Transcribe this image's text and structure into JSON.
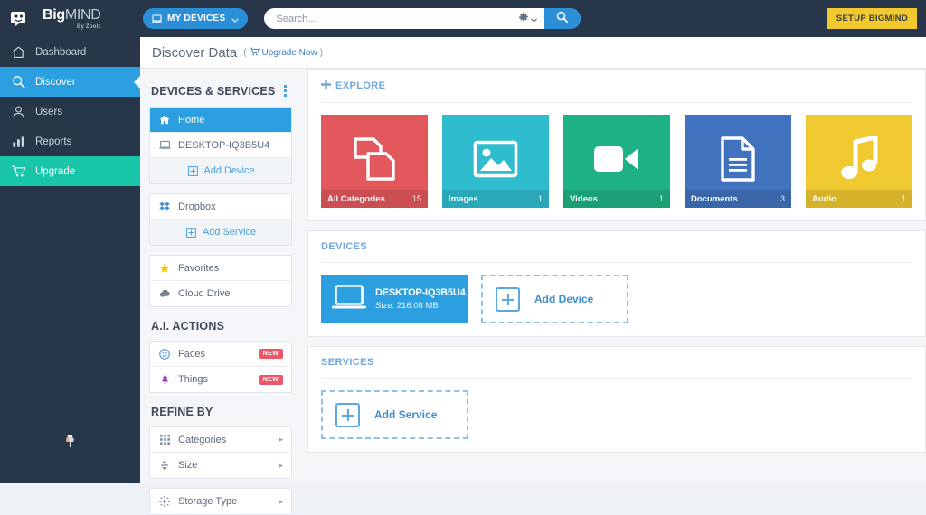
{
  "topbar": {
    "logo_main": "Big",
    "logo_dim": "MIND",
    "logo_sub": "By Zoolz",
    "my_devices_label": "MY DEVICES",
    "search_placeholder": "Search...",
    "setup_label": "SETUP BIGMIND"
  },
  "leftnav": {
    "items": [
      {
        "label": "Dashboard",
        "icon": "home-icon",
        "state": ""
      },
      {
        "label": "Discover",
        "icon": "search-icon",
        "state": "active"
      },
      {
        "label": "Users",
        "icon": "users-icon",
        "state": ""
      },
      {
        "label": "Reports",
        "icon": "chart-bar-icon",
        "state": ""
      },
      {
        "label": "Upgrade",
        "icon": "cart-icon",
        "state": "upgrade"
      }
    ],
    "pin_icon": "pushpin-icon"
  },
  "page": {
    "title": "Discover Data",
    "paren_open": "(",
    "upgrade_now": "Upgrade Now",
    "paren_close": ")"
  },
  "sidebar": {
    "devices_services_header": "DEVICES & SERVICES",
    "devices_items": [
      {
        "label": "Home",
        "icon": "home-icon",
        "kind": "sel"
      },
      {
        "label": "DESKTOP-IQ3B5U4",
        "icon": "laptop-icon",
        "kind": ""
      },
      {
        "label": "Add Device",
        "icon": "plus-square-icon",
        "kind": "add"
      }
    ],
    "services_items": [
      {
        "label": "Dropbox",
        "icon": "dropbox-icon",
        "kind": ""
      },
      {
        "label": "Add Service",
        "icon": "plus-square-icon",
        "kind": "add"
      }
    ],
    "extra_items": [
      {
        "label": "Favorites",
        "icon": "star-icon",
        "kind": ""
      },
      {
        "label": "Cloud Drive",
        "icon": "cloud-icon",
        "kind": ""
      }
    ],
    "ai_header": "A.I. ACTIONS",
    "ai_items": [
      {
        "label": "Faces",
        "icon": "smiley-face-icon",
        "badge": "NEW"
      },
      {
        "label": "Things",
        "icon": "tree-icon",
        "badge": "NEW"
      }
    ],
    "refine_header": "REFINE BY",
    "refine_items": [
      {
        "label": "Categories",
        "icon": "grid-icon"
      },
      {
        "label": "Size",
        "icon": "sort-size-icon"
      }
    ],
    "refine_items2": [
      {
        "label": "Storage Type",
        "icon": "storage-node-icon"
      }
    ]
  },
  "main": {
    "explore_header": "EXPLORE",
    "tiles": [
      {
        "label": "All Categories",
        "count": "15",
        "color": "#e2585c",
        "icon": "copy-files-icon"
      },
      {
        "label": "Images",
        "count": "1",
        "color": "#2fbcce",
        "icon": "image-icon"
      },
      {
        "label": "Videos",
        "count": "1",
        "color": "#1eb185",
        "icon": "video-camera-icon"
      },
      {
        "label": "Documents",
        "count": "3",
        "color": "#4072bd",
        "icon": "document-icon"
      },
      {
        "label": "Audio",
        "count": "1",
        "color": "#f0c830",
        "icon": "music-note-icon"
      }
    ],
    "devices_header": "DEVICES",
    "device": {
      "name": "DESKTOP-IQ3B5U4",
      "size": "Size: 216.08 MB",
      "icon": "laptop-icon"
    },
    "add_device_label": "Add Device",
    "services_header": "SERVICES",
    "add_service_label": "Add Service"
  },
  "colors": {
    "topbar_bg": "#273649",
    "accent_blue": "#2b9fe0",
    "upgrade_teal": "#18c5a9",
    "setup_yellow": "#f2ca30",
    "badge_red": "#f0566a"
  }
}
